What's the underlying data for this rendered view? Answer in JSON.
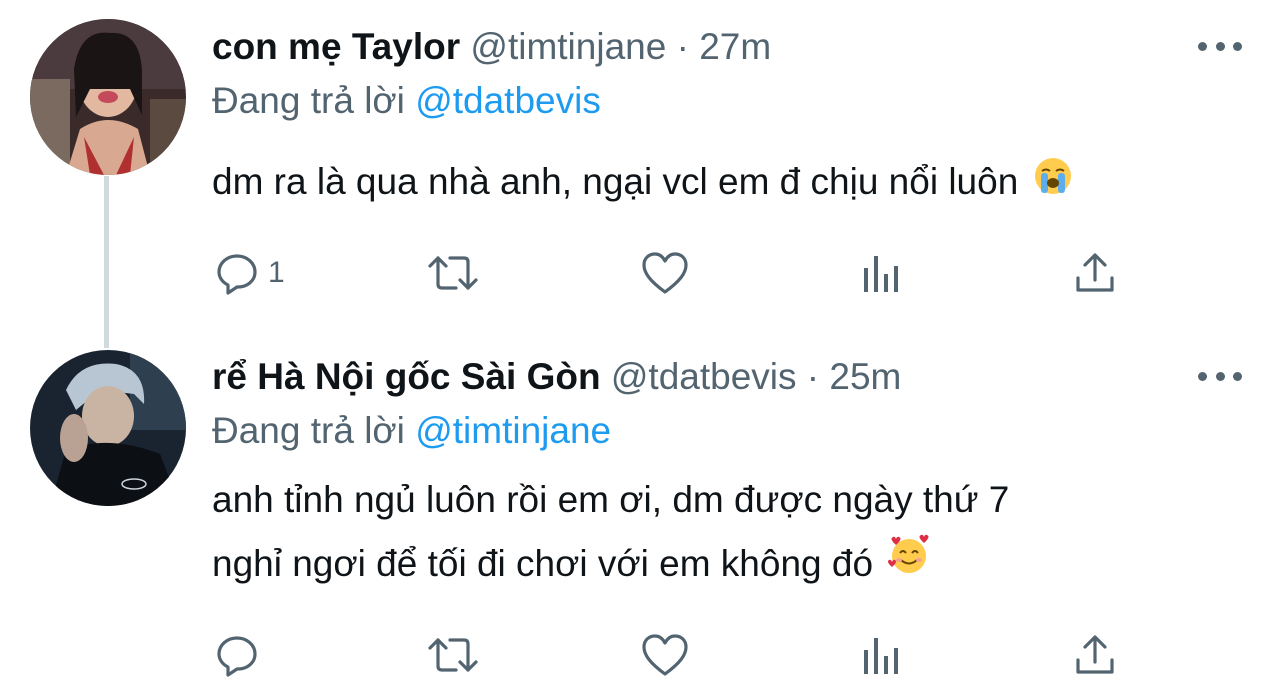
{
  "tweets": [
    {
      "display_name": "con mẹ Taylor",
      "handle": "@timtinjane",
      "separator": "·",
      "time": "27m",
      "reply_prefix": "Đang trả lời",
      "reply_to": "@tdatbevis",
      "text_lines": [
        "dm ra là qua nhà anh, ngại vcl em đ chịu nổi luôn"
      ],
      "emoji": "loudly-crying-face",
      "reply_count": "1"
    },
    {
      "display_name": "rể Hà Nội gốc Sài Gòn",
      "handle": "@tdatbevis",
      "separator": "·",
      "time": "25m",
      "reply_prefix": "Đang trả lời",
      "reply_to": "@timtinjane",
      "text_lines": [
        "anh tỉnh ngủ luôn rồi em ơi, dm được ngày thứ 7",
        "nghỉ ngơi để tối đi chơi với em không đó"
      ],
      "emoji": "smiling-face-with-hearts",
      "reply_count": ""
    }
  ],
  "icons": [
    "reply-icon",
    "retweet-icon",
    "like-icon",
    "analytics-icon",
    "share-icon",
    "more-icon"
  ],
  "colors": {
    "text": "#0f1419",
    "secondary": "#536471",
    "accent": "#1d9bf0",
    "thread_line": "#cfd9de"
  }
}
